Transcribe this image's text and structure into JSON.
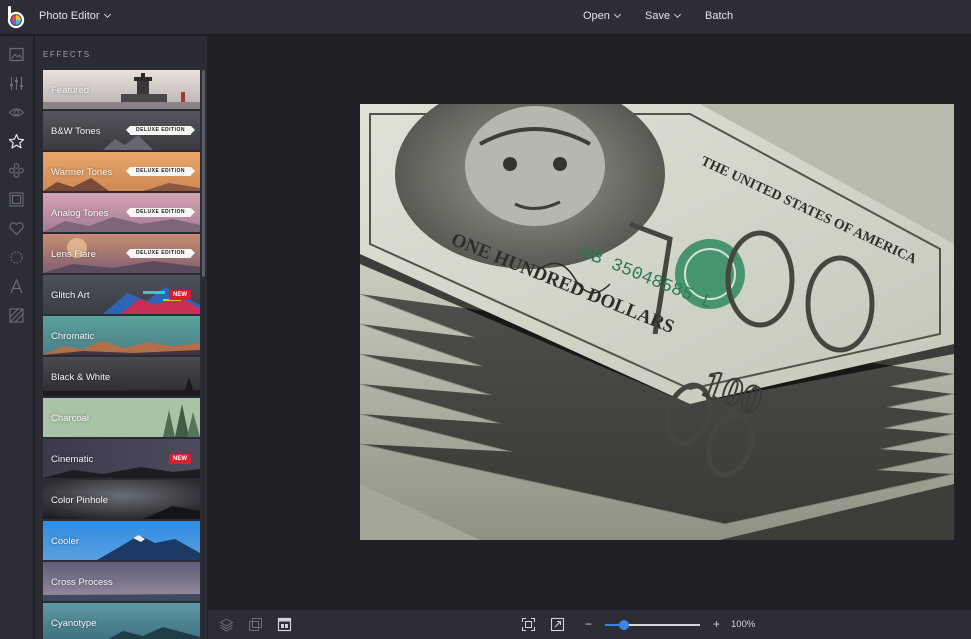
{
  "header": {
    "app_title": "Photo Editor",
    "menus": [
      {
        "label": "Open",
        "has_dropdown": true
      },
      {
        "label": "Save",
        "has_dropdown": true
      },
      {
        "label": "Batch",
        "has_dropdown": false
      }
    ]
  },
  "rail": {
    "icons": [
      "image-icon",
      "sliders-icon",
      "eye-icon",
      "star-icon",
      "touchup-icon",
      "frame-icon",
      "heart-icon",
      "texture-icon",
      "text-icon",
      "pattern-icon"
    ],
    "active": "star-icon"
  },
  "effects": {
    "section_title": "EFFECTS",
    "items": [
      {
        "label": "Featured",
        "badge": ""
      },
      {
        "label": "B&W Tones",
        "badge": "DELUXE EDITION"
      },
      {
        "label": "Warmer Tones",
        "badge": "DELUXE EDITION"
      },
      {
        "label": "Analog Tones",
        "badge": "DELUXE EDITION"
      },
      {
        "label": "Lens Flare",
        "badge": "DELUXE EDITION"
      },
      {
        "label": "Glitch Art",
        "badge": "NEW"
      },
      {
        "label": "Chromatic",
        "badge": ""
      },
      {
        "label": "Black & White",
        "badge": ""
      },
      {
        "label": "Charcoal",
        "badge": ""
      },
      {
        "label": "Cinematic",
        "badge": "NEW"
      },
      {
        "label": "Color Pinhole",
        "badge": ""
      },
      {
        "label": "Cooler",
        "badge": ""
      },
      {
        "label": "Cross Process",
        "badge": ""
      },
      {
        "label": "Cyanotype",
        "badge": ""
      }
    ]
  },
  "canvas": {
    "banknote": {
      "serial": "HB 35048585 L",
      "denomination_words": "ONE HUNDRED DOLLARS",
      "country": "THE UNITED STATES OF AMERICA",
      "value": "100"
    }
  },
  "bottom": {
    "icons": [
      "layers-icon",
      "compare-icon",
      "preview-icon",
      "fit-screen-icon",
      "expand-icon"
    ],
    "zoom": {
      "minus": "−",
      "plus": "+",
      "level": "100%",
      "slider_fraction": 0.2
    }
  },
  "colors": {
    "accent": "#3a86e6",
    "new_badge": "#d6202b",
    "topbar": "#2c2d35",
    "workspace": "#202127"
  }
}
